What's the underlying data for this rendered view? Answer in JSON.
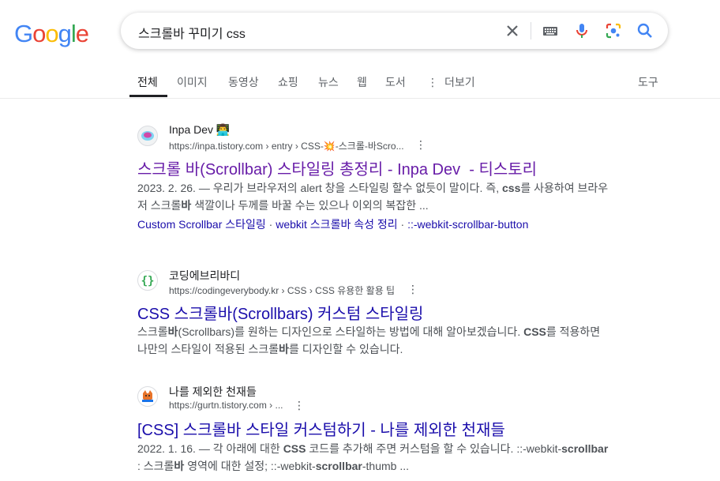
{
  "logo": {
    "letters": [
      "G",
      "o",
      "o",
      "g",
      "l",
      "e"
    ],
    "colors": [
      "#4285f4",
      "#ea4335",
      "#fbbc05",
      "#4285f4",
      "#34a853",
      "#ea4335"
    ]
  },
  "search": {
    "query": "스크롤바 꾸미기 css"
  },
  "icons": {
    "clear": "close-icon",
    "keyboard": "keyboard-icon",
    "voice": "microphone-icon",
    "lens": "camera-lens-icon",
    "search": "search-icon"
  },
  "tabs": [
    "전체",
    "이미지",
    "동영상",
    "쇼핑",
    "뉴스",
    "웹",
    "도서",
    "더보기"
  ],
  "tools_label": "도구",
  "results": [
    {
      "site_name": "Inpa Dev 👨‍💻",
      "url": "https://inpa.tistory.com › entry › CSS-💥-스크롤-바Scro...",
      "title": "스크롤 바(Scrollbar) 스타일링 총정리 - Inpa Dev ‍ - 티스토리",
      "snippet_date": "2023. 2. 26. — ",
      "snippet_1": "우리가 브라우저의 alert 창을 스타일링 할수 없듯이 말이다. 즉, ",
      "snippet_bold_1": "css",
      "snippet_2": "를 사용하여 브라우저 스크롤",
      "snippet_bold_2": "바",
      "snippet_3": " 색깔이나 두께를 바꿀 수는 있으나 이외의 복잡한 ...",
      "sitelinks": [
        "Custom Scrollbar 스타일링",
        "webkit 스크롤바 속성 정리",
        "::-webkit-scrollbar-button"
      ]
    },
    {
      "site_name": "코딩에브리바디",
      "url": "https://codingeverybody.kr › CSS › CSS 유용한 활용 팁",
      "title": "CSS 스크롤바(Scrollbars) 커스텀 스타일링",
      "snippet_1": "스크롤",
      "snippet_bold_1": "바",
      "snippet_2": "(Scrollbars)를 원하는 디자인으로 스타일하는 방법에 대해 알아보겠습니다. ",
      "snippet_bold_2": "CSS",
      "snippet_3": "를 적용하면 나만의 스타일이 적용된 스크롤",
      "snippet_bold_3": "바",
      "snippet_4": "를 디자인할 수 있습니다."
    },
    {
      "site_name": "나를 제외한 천재들",
      "url": "https://gurtn.tistory.com › ...",
      "title": "[CSS] 스크롤바 스타일 커스텀하기 - 나를 제외한 천재들",
      "snippet_date": "2022. 1. 16. — ",
      "snippet_1": "각 아래에 대한 ",
      "snippet_bold_1": "CSS",
      "snippet_2": " 코드를 추가해 주면 커스텀을 할 수 있습니다. ::-webkit-",
      "snippet_bold_2": "scrollbar",
      "snippet_3": " : 스크롤",
      "snippet_bold_3": "바",
      "snippet_4": " 영역에 대한 설정; ::-webkit-",
      "snippet_bold_4": "scrollbar",
      "snippet_5": "-thumb ..."
    }
  ]
}
